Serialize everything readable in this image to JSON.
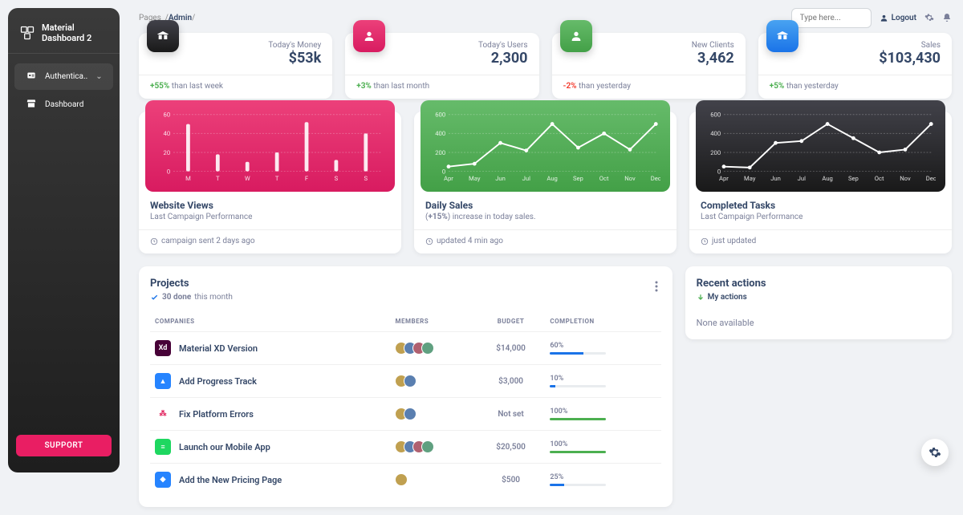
{
  "brand": "Material Dashboard 2",
  "sidebar": {
    "items": [
      {
        "label": "Authentica..",
        "icon": "badge-icon"
      },
      {
        "label": "Dashboard",
        "icon": "store-icon"
      }
    ],
    "support_label": "SUPPORT"
  },
  "breadcrumb": {
    "root": "Pages",
    "current": "Admin"
  },
  "topbar": {
    "search_placeholder": "Type here...",
    "logout_label": "Logout"
  },
  "stats": [
    {
      "icon": "dark",
      "name": "weekend-icon",
      "label": "Today's Money",
      "value": "$53k",
      "delta": "+55%",
      "delta_sign": "pos",
      "tail": " than last week"
    },
    {
      "icon": "pink",
      "name": "person-icon",
      "label": "Today's Users",
      "value": "2,300",
      "delta": "+3%",
      "delta_sign": "pos",
      "tail": " than last month"
    },
    {
      "icon": "green",
      "name": "person-icon",
      "label": "New Clients",
      "value": "3,462",
      "delta": "-2%",
      "delta_sign": "neg",
      "tail": " than yesterday"
    },
    {
      "icon": "blue",
      "name": "weekend-icon",
      "label": "Sales",
      "value": "$103,430",
      "delta": "+5%",
      "delta_sign": "pos",
      "tail": " than yesterday"
    }
  ],
  "chart_data": [
    {
      "type": "bar",
      "title": "Website Views",
      "sub": "Last Campaign Performance",
      "foot": "campaign sent 2 days ago",
      "bg": "pink",
      "categories": [
        "M",
        "T",
        "W",
        "T",
        "F",
        "S",
        "S"
      ],
      "values": [
        50,
        18,
        10,
        20,
        52,
        12,
        40
      ],
      "ylim": [
        0,
        60
      ],
      "yticks": [
        0,
        20,
        40,
        60
      ]
    },
    {
      "type": "line",
      "title": "Daily Sales",
      "sub_html": "(<b>+15%</b>) increase in today sales.",
      "foot": "updated 4 min ago",
      "bg": "green",
      "categories": [
        "Apr",
        "May",
        "Jun",
        "Jul",
        "Aug",
        "Sep",
        "Oct",
        "Nov",
        "Dec"
      ],
      "values": [
        50,
        80,
        300,
        220,
        500,
        250,
        400,
        230,
        500
      ],
      "ylim": [
        0,
        600
      ],
      "yticks": [
        0,
        200,
        400,
        600
      ]
    },
    {
      "type": "line",
      "title": "Completed Tasks",
      "sub": "Last Campaign Performance",
      "foot": "just updated",
      "bg": "dark",
      "categories": [
        "Apr",
        "May",
        "Jun",
        "Jul",
        "Aug",
        "Sep",
        "Oct",
        "Nov",
        "Dec"
      ],
      "values": [
        50,
        40,
        300,
        320,
        500,
        350,
        200,
        230,
        500
      ],
      "ylim": [
        0,
        600
      ],
      "yticks": [
        0,
        200,
        400,
        600
      ]
    }
  ],
  "projects": {
    "title": "Projects",
    "subtitle_prefix": "30 done",
    "subtitle_tail": " this month",
    "columns": [
      "COMPANIES",
      "MEMBERS",
      "BUDGET",
      "COMPLETION"
    ],
    "rows": [
      {
        "company": "Material XD Version",
        "icon_bg": "#470137",
        "icon_txt": "Xd",
        "members": 4,
        "budget": "$14,000",
        "completion": "60%",
        "pct": 60,
        "bar": "blue"
      },
      {
        "company": "Add Progress Track",
        "icon_bg": "#2684ff",
        "icon_txt": "▲",
        "members": 2,
        "budget": "$3,000",
        "completion": "10%",
        "pct": 10,
        "bar": "blue"
      },
      {
        "company": "Fix Platform Errors",
        "icon_bg": "#ffffff",
        "icon_txt": "⁂",
        "icon_fg": "#e01e5a",
        "members": 2,
        "budget": "Not set",
        "completion": "100%",
        "pct": 100,
        "bar": "green"
      },
      {
        "company": "Launch our Mobile App",
        "icon_bg": "#1ed760",
        "icon_txt": "≡",
        "members": 4,
        "budget": "$20,500",
        "completion": "100%",
        "pct": 100,
        "bar": "green"
      },
      {
        "company": "Add the New Pricing Page",
        "icon_bg": "#2684ff",
        "icon_txt": "◆",
        "members": 1,
        "budget": "$500",
        "completion": "25%",
        "pct": 25,
        "bar": "blue"
      }
    ]
  },
  "recent": {
    "title": "Recent actions",
    "link_label": "My actions",
    "empty": "None available"
  },
  "avatar_colors": [
    "#c0a050",
    "#5a7fb0",
    "#b06070",
    "#60a080"
  ]
}
